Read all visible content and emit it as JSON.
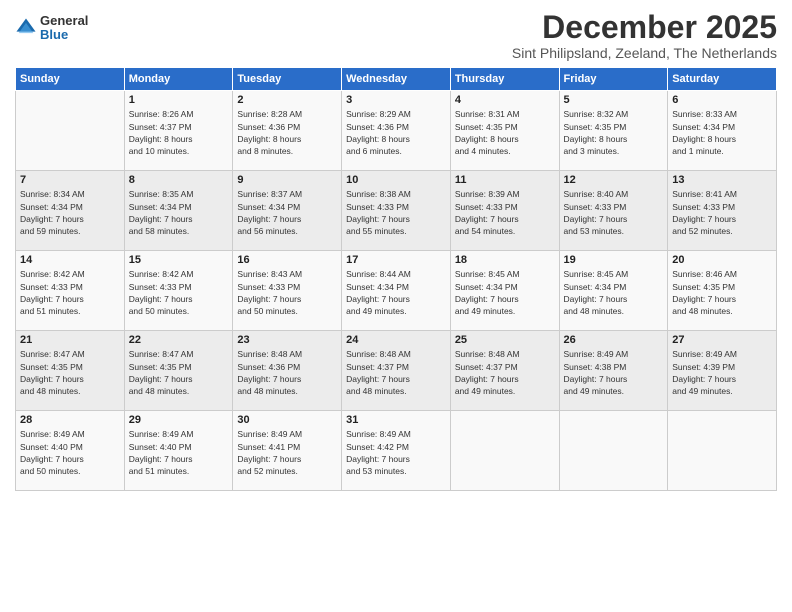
{
  "logo": {
    "general": "General",
    "blue": "Blue"
  },
  "title": "December 2025",
  "location": "Sint Philipsland, Zeeland, The Netherlands",
  "headers": [
    "Sunday",
    "Monday",
    "Tuesday",
    "Wednesday",
    "Thursday",
    "Friday",
    "Saturday"
  ],
  "weeks": [
    [
      {
        "day": "",
        "info": ""
      },
      {
        "day": "1",
        "info": "Sunrise: 8:26 AM\nSunset: 4:37 PM\nDaylight: 8 hours\nand 10 minutes."
      },
      {
        "day": "2",
        "info": "Sunrise: 8:28 AM\nSunset: 4:36 PM\nDaylight: 8 hours\nand 8 minutes."
      },
      {
        "day": "3",
        "info": "Sunrise: 8:29 AM\nSunset: 4:36 PM\nDaylight: 8 hours\nand 6 minutes."
      },
      {
        "day": "4",
        "info": "Sunrise: 8:31 AM\nSunset: 4:35 PM\nDaylight: 8 hours\nand 4 minutes."
      },
      {
        "day": "5",
        "info": "Sunrise: 8:32 AM\nSunset: 4:35 PM\nDaylight: 8 hours\nand 3 minutes."
      },
      {
        "day": "6",
        "info": "Sunrise: 8:33 AM\nSunset: 4:34 PM\nDaylight: 8 hours\nand 1 minute."
      }
    ],
    [
      {
        "day": "7",
        "info": "Sunrise: 8:34 AM\nSunset: 4:34 PM\nDaylight: 7 hours\nand 59 minutes."
      },
      {
        "day": "8",
        "info": "Sunrise: 8:35 AM\nSunset: 4:34 PM\nDaylight: 7 hours\nand 58 minutes."
      },
      {
        "day": "9",
        "info": "Sunrise: 8:37 AM\nSunset: 4:34 PM\nDaylight: 7 hours\nand 56 minutes."
      },
      {
        "day": "10",
        "info": "Sunrise: 8:38 AM\nSunset: 4:33 PM\nDaylight: 7 hours\nand 55 minutes."
      },
      {
        "day": "11",
        "info": "Sunrise: 8:39 AM\nSunset: 4:33 PM\nDaylight: 7 hours\nand 54 minutes."
      },
      {
        "day": "12",
        "info": "Sunrise: 8:40 AM\nSunset: 4:33 PM\nDaylight: 7 hours\nand 53 minutes."
      },
      {
        "day": "13",
        "info": "Sunrise: 8:41 AM\nSunset: 4:33 PM\nDaylight: 7 hours\nand 52 minutes."
      }
    ],
    [
      {
        "day": "14",
        "info": "Sunrise: 8:42 AM\nSunset: 4:33 PM\nDaylight: 7 hours\nand 51 minutes."
      },
      {
        "day": "15",
        "info": "Sunrise: 8:42 AM\nSunset: 4:33 PM\nDaylight: 7 hours\nand 50 minutes."
      },
      {
        "day": "16",
        "info": "Sunrise: 8:43 AM\nSunset: 4:33 PM\nDaylight: 7 hours\nand 50 minutes."
      },
      {
        "day": "17",
        "info": "Sunrise: 8:44 AM\nSunset: 4:34 PM\nDaylight: 7 hours\nand 49 minutes."
      },
      {
        "day": "18",
        "info": "Sunrise: 8:45 AM\nSunset: 4:34 PM\nDaylight: 7 hours\nand 49 minutes."
      },
      {
        "day": "19",
        "info": "Sunrise: 8:45 AM\nSunset: 4:34 PM\nDaylight: 7 hours\nand 48 minutes."
      },
      {
        "day": "20",
        "info": "Sunrise: 8:46 AM\nSunset: 4:35 PM\nDaylight: 7 hours\nand 48 minutes."
      }
    ],
    [
      {
        "day": "21",
        "info": "Sunrise: 8:47 AM\nSunset: 4:35 PM\nDaylight: 7 hours\nand 48 minutes."
      },
      {
        "day": "22",
        "info": "Sunrise: 8:47 AM\nSunset: 4:35 PM\nDaylight: 7 hours\nand 48 minutes."
      },
      {
        "day": "23",
        "info": "Sunrise: 8:48 AM\nSunset: 4:36 PM\nDaylight: 7 hours\nand 48 minutes."
      },
      {
        "day": "24",
        "info": "Sunrise: 8:48 AM\nSunset: 4:37 PM\nDaylight: 7 hours\nand 48 minutes."
      },
      {
        "day": "25",
        "info": "Sunrise: 8:48 AM\nSunset: 4:37 PM\nDaylight: 7 hours\nand 49 minutes."
      },
      {
        "day": "26",
        "info": "Sunrise: 8:49 AM\nSunset: 4:38 PM\nDaylight: 7 hours\nand 49 minutes."
      },
      {
        "day": "27",
        "info": "Sunrise: 8:49 AM\nSunset: 4:39 PM\nDaylight: 7 hours\nand 49 minutes."
      }
    ],
    [
      {
        "day": "28",
        "info": "Sunrise: 8:49 AM\nSunset: 4:40 PM\nDaylight: 7 hours\nand 50 minutes."
      },
      {
        "day": "29",
        "info": "Sunrise: 8:49 AM\nSunset: 4:40 PM\nDaylight: 7 hours\nand 51 minutes."
      },
      {
        "day": "30",
        "info": "Sunrise: 8:49 AM\nSunset: 4:41 PM\nDaylight: 7 hours\nand 52 minutes."
      },
      {
        "day": "31",
        "info": "Sunrise: 8:49 AM\nSunset: 4:42 PM\nDaylight: 7 hours\nand 53 minutes."
      },
      {
        "day": "",
        "info": ""
      },
      {
        "day": "",
        "info": ""
      },
      {
        "day": "",
        "info": ""
      }
    ]
  ]
}
